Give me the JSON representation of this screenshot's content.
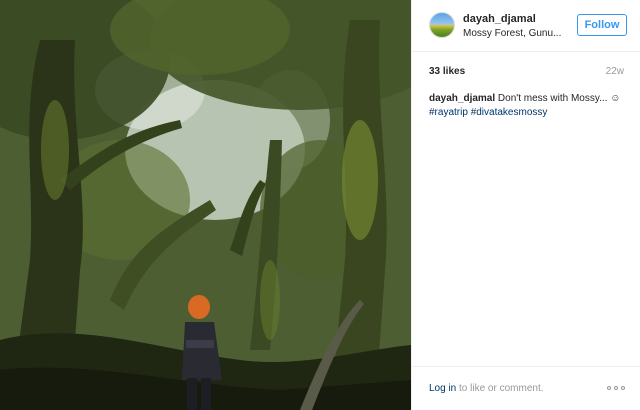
{
  "photo": {
    "description_icon": "forest-photo"
  },
  "header": {
    "username": "dayah_djamal",
    "location": "Mossy Forest, Gunu...",
    "follow_label": "Follow",
    "avatar_icon": "profile-avatar"
  },
  "stats": {
    "likes": "33 likes",
    "age": "22w"
  },
  "caption": {
    "user": "dayah_djamal",
    "text": " Don't mess with Mossy... ☺",
    "tag1": "#rayatrip",
    "tag2": "#divatakesmossy"
  },
  "footer": {
    "login_label": "Log in",
    "login_suffix": " to like or comment.",
    "more_icon": "more-options-icon"
  },
  "colors": {
    "accent": "#3897f0",
    "link": "#003569",
    "muted": "#999999"
  }
}
